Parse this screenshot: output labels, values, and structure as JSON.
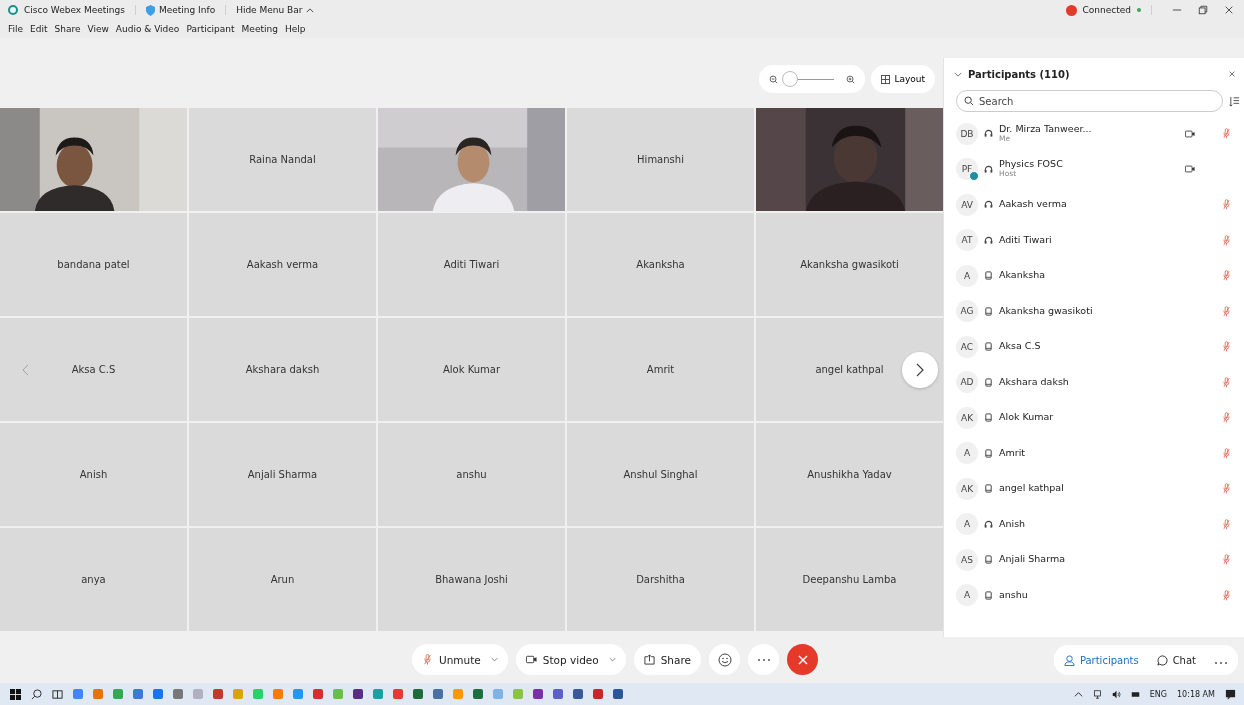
{
  "title_bar": {
    "app_name": "Cisco Webex Meetings",
    "meeting_info": "Meeting Info",
    "hide_menu": "Hide Menu Bar",
    "connection": "Connected"
  },
  "menu": [
    "File",
    "Edit",
    "Share",
    "View",
    "Audio & Video",
    "Participant",
    "Meeting",
    "Help"
  ],
  "stage": {
    "layout_button": "Layout",
    "zoom": {
      "level": 0.0
    },
    "tiles": [
      {
        "kind": "picture"
      },
      {
        "kind": "name",
        "name": "Raina Nandal"
      },
      {
        "kind": "picture"
      },
      {
        "kind": "name",
        "name": "Himanshi"
      },
      {
        "kind": "picture"
      },
      {
        "kind": "name",
        "name": "bandana patel"
      },
      {
        "kind": "name",
        "name": "Aakash verma"
      },
      {
        "kind": "name",
        "name": "Aditi Tiwari"
      },
      {
        "kind": "name",
        "name": "Akanksha"
      },
      {
        "kind": "name",
        "name": "Akanksha gwasikoti"
      },
      {
        "kind": "name",
        "name": "Aksa C.S"
      },
      {
        "kind": "name",
        "name": "Akshara daksh"
      },
      {
        "kind": "name",
        "name": "Alok Kumar"
      },
      {
        "kind": "name",
        "name": "Amrit"
      },
      {
        "kind": "name",
        "name": "angel kathpal"
      },
      {
        "kind": "name",
        "name": "Anish"
      },
      {
        "kind": "name",
        "name": "Anjali Sharma"
      },
      {
        "kind": "name",
        "name": "anshu"
      },
      {
        "kind": "name",
        "name": "Anshul Singhal"
      },
      {
        "kind": "name",
        "name": "Anushikha Yadav"
      },
      {
        "kind": "name",
        "name": "anya"
      },
      {
        "kind": "name",
        "name": "Arun"
      },
      {
        "kind": "name",
        "name": "Bhawana Joshi"
      },
      {
        "kind": "name",
        "name": "Darshitha"
      },
      {
        "kind": "name",
        "name": "Deepanshu Lamba"
      }
    ]
  },
  "participants": {
    "title": "Participants (110)",
    "search": {
      "placeholder": "Search"
    },
    "rows": [
      {
        "initials": "DB",
        "kind": "computer",
        "name": "Dr. Mirza Tanweer...",
        "role": "Me",
        "video": true,
        "muted": true,
        "status_dot": false
      },
      {
        "initials": "PF",
        "kind": "computer",
        "name": "Physics FOSC",
        "role": "Host",
        "video": true,
        "muted": false,
        "status_dot": true
      },
      {
        "initials": "AV",
        "kind": "computer",
        "name": "Aakash verma",
        "video": false,
        "muted": true,
        "status_dot": false
      },
      {
        "initials": "AT",
        "kind": "computer",
        "name": "Aditi Tiwari",
        "video": false,
        "muted": true,
        "status_dot": false
      },
      {
        "initials": "A",
        "kind": "phone",
        "name": "Akanksha",
        "video": false,
        "muted": true,
        "status_dot": false
      },
      {
        "initials": "AG",
        "kind": "phone",
        "name": "Akanksha gwasikoti",
        "video": false,
        "muted": true,
        "status_dot": false
      },
      {
        "initials": "AC",
        "kind": "phone",
        "name": "Aksa C.S",
        "video": false,
        "muted": true,
        "status_dot": false
      },
      {
        "initials": "AD",
        "kind": "phone",
        "name": "Akshara daksh",
        "video": false,
        "muted": true,
        "status_dot": false
      },
      {
        "initials": "AK",
        "kind": "phone",
        "name": "Alok Kumar",
        "video": false,
        "muted": true,
        "status_dot": false
      },
      {
        "initials": "A",
        "kind": "phone",
        "name": "Amrit",
        "video": false,
        "muted": true,
        "status_dot": false
      },
      {
        "initials": "AK",
        "kind": "phone",
        "name": "angel kathpal",
        "video": false,
        "muted": true,
        "status_dot": false
      },
      {
        "initials": "A",
        "kind": "computer",
        "name": "Anish",
        "video": false,
        "muted": true,
        "status_dot": false
      },
      {
        "initials": "AS",
        "kind": "phone",
        "name": "Anjali Sharma",
        "video": false,
        "muted": true,
        "status_dot": false
      },
      {
        "initials": "A",
        "kind": "phone",
        "name": "anshu",
        "video": false,
        "muted": true,
        "status_dot": false
      }
    ]
  },
  "controls": {
    "unmute": "Unmute",
    "stop_video": "Stop video",
    "share": "Share",
    "participants": {
      "label": "Participants",
      "selected": true
    },
    "chat": {
      "label": "Chat",
      "selected": false
    }
  },
  "taskbar": {
    "language": "ENG",
    "time": "10:18 AM"
  }
}
